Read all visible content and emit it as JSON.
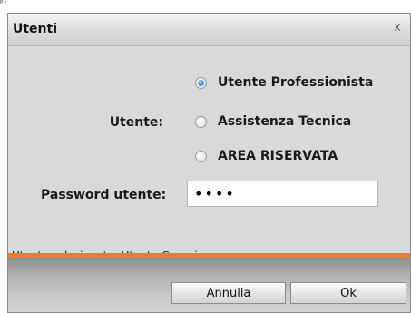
{
  "window": {
    "title": "Utenti",
    "close_label": "x"
  },
  "form": {
    "user_label": "Utente:",
    "user_options": [
      {
        "label": "Utente Professionista",
        "checked": true
      },
      {
        "label": "Assistenza Tecnica",
        "checked": false
      },
      {
        "label": "AREA RISERVATA",
        "checked": false
      }
    ],
    "password_label": "Password utente:",
    "password_value": "abcd"
  },
  "status": {
    "text": "Utente selezionato: Utente Generico"
  },
  "footer": {
    "cancel_label": "Annulla",
    "ok_label": "Ok"
  },
  "colors": {
    "accent_line": "#f07a2e",
    "radio_selected": "#3d7fd6"
  }
}
